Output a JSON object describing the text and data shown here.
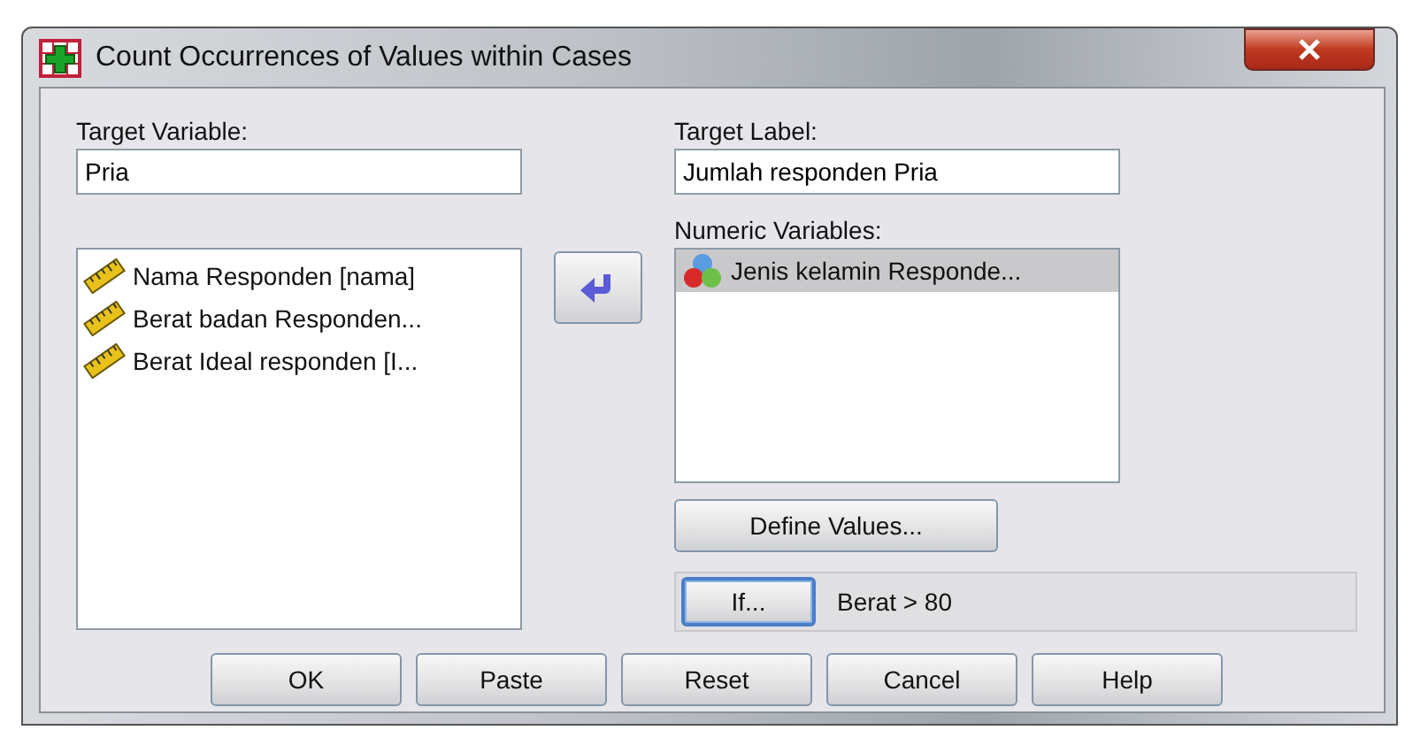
{
  "window": {
    "title": "Count Occurrences of Values within Cases"
  },
  "target_variable": {
    "label": "Target Variable:",
    "value": "Pria"
  },
  "target_label": {
    "label": "Target Label:",
    "value": "Jumlah responden Pria"
  },
  "source_variables": [
    {
      "name": "Nama Responden [nama]",
      "kind": "scale",
      "selected": false
    },
    {
      "name": "Berat badan Responden...",
      "kind": "scale",
      "selected": false
    },
    {
      "name": "Berat Ideal responden [I...",
      "kind": "scale",
      "selected": false
    }
  ],
  "numeric_variables": {
    "label": "Numeric Variables:",
    "items": [
      {
        "name": "Jenis kelamin Responde...",
        "kind": "nominal",
        "selected": true
      }
    ]
  },
  "define_values_button": {
    "label": "Define Values..."
  },
  "if_condition": {
    "button": "If...",
    "condition": "Berat > 80"
  },
  "buttons": [
    {
      "label": "OK"
    },
    {
      "label": "Paste"
    },
    {
      "label": "Reset"
    },
    {
      "label": "Cancel"
    },
    {
      "label": "Help"
    }
  ]
}
